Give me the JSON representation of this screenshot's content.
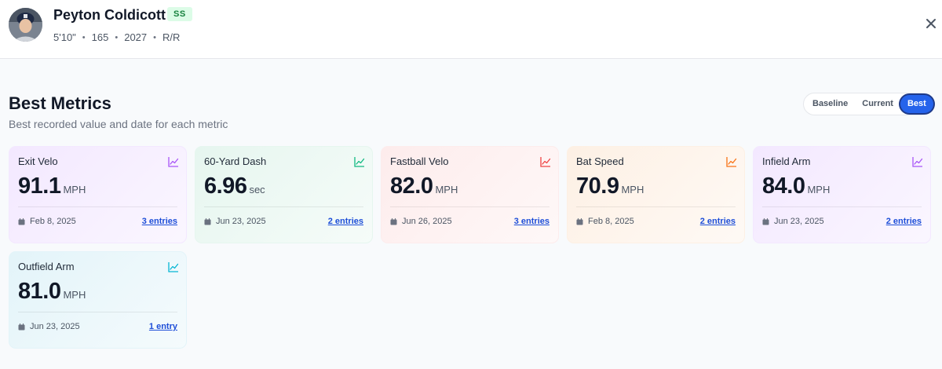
{
  "player": {
    "name": "Peyton Coldicott",
    "position": "SS",
    "height": "5'10\"",
    "weight": "165",
    "class_year": "2027",
    "bats_throws": "R/R",
    "separator": "•"
  },
  "icons": {
    "close": "close-icon",
    "trend": "trend-chart-icon",
    "calendar": "calendar-icon"
  },
  "section": {
    "title": "Best Metrics",
    "subtitle": "Best recorded value and date for each metric"
  },
  "toggle": {
    "options": [
      "Baseline",
      "Current",
      "Best"
    ],
    "selected": "Best"
  },
  "metrics": [
    {
      "label": "Exit Velo",
      "value": "91.1",
      "unit": "MPH",
      "date": "Feb 8, 2025",
      "entries": "3 entries",
      "accent": "#a855f7",
      "bg": "#f3e8ff"
    },
    {
      "label": "60-Yard Dash",
      "value": "6.96",
      "unit": "sec",
      "date": "Jun 23, 2025",
      "entries": "2 entries",
      "accent": "#10b981",
      "bg": "#e6f6ef"
    },
    {
      "label": "Fastball Velo",
      "value": "82.0",
      "unit": "MPH",
      "date": "Jun 26, 2025",
      "entries": "3 entries",
      "accent": "#ef4444",
      "bg": "#fdecec"
    },
    {
      "label": "Bat Speed",
      "value": "70.9",
      "unit": "MPH",
      "date": "Feb 8, 2025",
      "entries": "2 entries",
      "accent": "#f97316",
      "bg": "#fdf0e4"
    },
    {
      "label": "Infield Arm",
      "value": "84.0",
      "unit": "MPH",
      "date": "Jun 23, 2025",
      "entries": "2 entries",
      "accent": "#a855f7",
      "bg": "#f3e8ff"
    },
    {
      "label": "Outfield Arm",
      "value": "81.0",
      "unit": "MPH",
      "date": "Jun 23, 2025",
      "entries": "1 entry",
      "accent": "#06b6d4",
      "bg": "#e3f4f9"
    }
  ]
}
